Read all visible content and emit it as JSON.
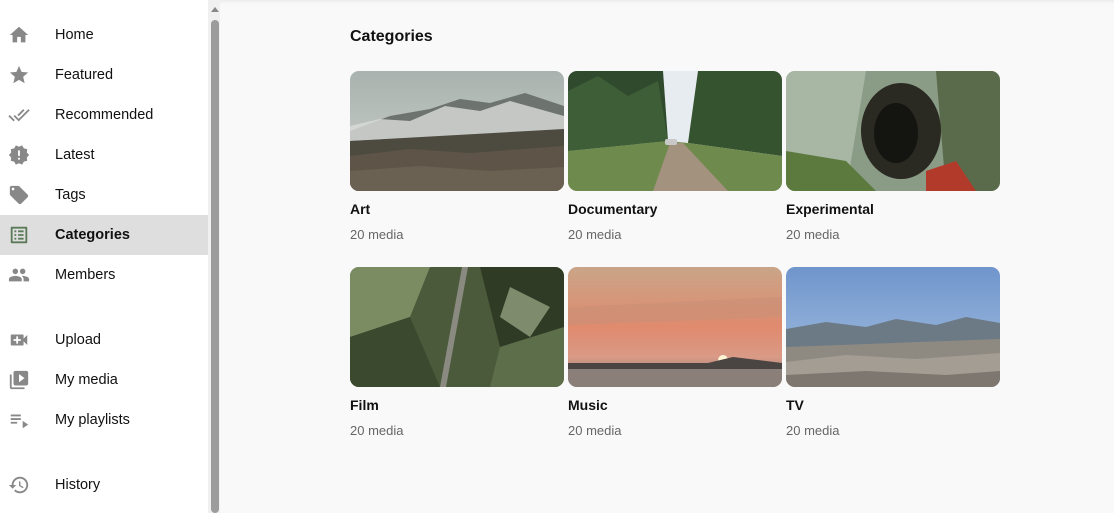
{
  "sidebar": {
    "items": [
      {
        "label": "Home",
        "icon": "home-icon"
      },
      {
        "label": "Featured",
        "icon": "star-icon"
      },
      {
        "label": "Recommended",
        "icon": "double-check-icon"
      },
      {
        "label": "Latest",
        "icon": "new-releases-icon"
      },
      {
        "label": "Tags",
        "icon": "tag-icon"
      },
      {
        "label": "Categories",
        "icon": "list-icon",
        "active": true
      },
      {
        "label": "Members",
        "icon": "people-icon"
      },
      {
        "label": "Upload",
        "icon": "video-add-icon"
      },
      {
        "label": "My media",
        "icon": "video-library-icon"
      },
      {
        "label": "My playlists",
        "icon": "playlist-icon"
      },
      {
        "label": "History",
        "icon": "history-icon"
      }
    ]
  },
  "main": {
    "title": "Categories",
    "categories": [
      {
        "name": "Art",
        "count": "20 media"
      },
      {
        "name": "Documentary",
        "count": "20 media"
      },
      {
        "name": "Experimental",
        "count": "20 media"
      },
      {
        "name": "Film",
        "count": "20 media"
      },
      {
        "name": "Music",
        "count": "20 media"
      },
      {
        "name": "TV",
        "count": "20 media"
      }
    ]
  },
  "colors": {
    "sidebar_bg": "#ffffff",
    "active_item_bg": "#dedede",
    "page_bg": "#f9f9f9",
    "icon_color": "#888888",
    "muted_text": "#666666"
  }
}
